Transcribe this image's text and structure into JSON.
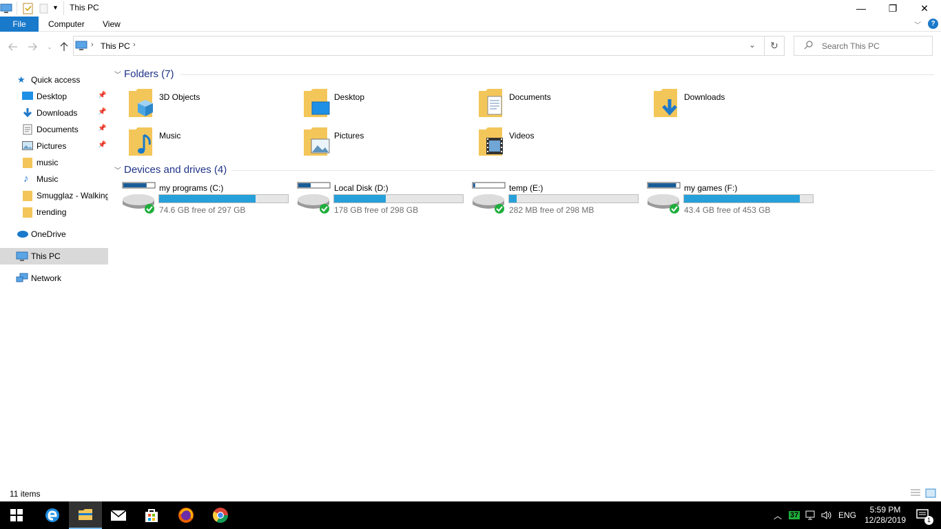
{
  "window": {
    "title": "This PC",
    "minimize": "—",
    "restore": "❐",
    "close": "✕"
  },
  "ribbon": {
    "tabs": [
      "File",
      "Computer",
      "View"
    ]
  },
  "address": {
    "path": [
      "This PC"
    ],
    "search_placeholder": "Search This PC"
  },
  "sidebar": {
    "quick_access": "Quick access",
    "items": [
      {
        "label": "Desktop",
        "pinned": true,
        "icon": "desktop-icon"
      },
      {
        "label": "Downloads",
        "pinned": true,
        "icon": "downloads-icon"
      },
      {
        "label": "Documents",
        "pinned": true,
        "icon": "documents-icon"
      },
      {
        "label": "Pictures",
        "pinned": true,
        "icon": "pictures-icon"
      },
      {
        "label": "music",
        "pinned": false,
        "icon": "folder-icon"
      },
      {
        "label": "Music",
        "pinned": false,
        "icon": "music-icon"
      },
      {
        "label": "Smugglaz - Walking",
        "pinned": false,
        "icon": "folder-icon"
      },
      {
        "label": "trending",
        "pinned": false,
        "icon": "folder-icon"
      }
    ],
    "onedrive": "OneDrive",
    "this_pc": "This PC",
    "network": "Network"
  },
  "folders": {
    "header": "Folders (7)",
    "items": [
      {
        "label": "3D Objects",
        "icon": "3d-objects-icon"
      },
      {
        "label": "Desktop",
        "icon": "desktop-folder-icon"
      },
      {
        "label": "Documents",
        "icon": "documents-folder-icon"
      },
      {
        "label": "Downloads",
        "icon": "downloads-folder-icon"
      },
      {
        "label": "Music",
        "icon": "music-folder-icon"
      },
      {
        "label": "Pictures",
        "icon": "pictures-folder-icon"
      },
      {
        "label": "Videos",
        "icon": "videos-folder-icon"
      }
    ]
  },
  "drives": {
    "header": "Devices and drives (4)",
    "items": [
      {
        "name": "my programs (C:)",
        "free_text": "74.6 GB free of 297 GB",
        "used_fraction": 0.75
      },
      {
        "name": "Local Disk (D:)",
        "free_text": "178 GB free of 298 GB",
        "used_fraction": 0.4
      },
      {
        "name": "temp (E:)",
        "free_text": "282 MB free of 298 MB",
        "used_fraction": 0.06
      },
      {
        "name": "my games (F:)",
        "free_text": "43.4 GB free of 453 GB",
        "used_fraction": 0.9
      }
    ]
  },
  "status": {
    "count": "11 items"
  },
  "taskbar": {
    "apps": [
      "start-icon",
      "edge-icon",
      "file-explorer-icon",
      "mail-icon",
      "store-icon",
      "firefox-icon",
      "chrome-icon"
    ],
    "battery": "37",
    "lang": "ENG",
    "time": "5:59 PM",
    "date": "12/28/2019",
    "notification_count": "1"
  },
  "colors": {
    "accent": "#1979ca",
    "bar_fill": "#26a0da",
    "header_text": "#1e3287",
    "folder_yellow": "#f3c65a"
  }
}
